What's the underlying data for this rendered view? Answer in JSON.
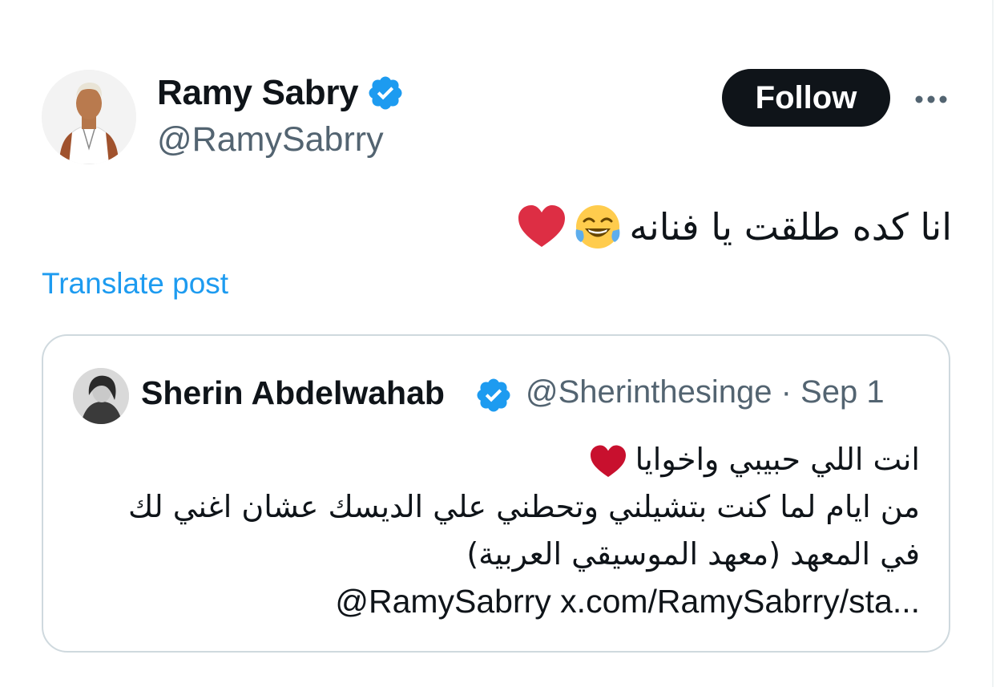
{
  "author": {
    "display_name": "Ramy Sabry",
    "handle": "@RamySabrry",
    "verified": true
  },
  "header": {
    "follow_label": "Follow"
  },
  "post": {
    "text": "انا كده طلقت يا فنانه",
    "emojis": [
      "face-with-tears-of-joy",
      "red-heart"
    ],
    "translate_label": "Translate post"
  },
  "quote": {
    "author_name": "Sherin Abdelwahab",
    "handle": "@Sherinthesinge",
    "separator": "·",
    "date": "Sep 1",
    "lines": [
      "انت اللي حبيبي واخوايا",
      "من ايام لما كنت بتشيلني وتحطني علي الديسك عشان اغني لك",
      "في المعهد (معهد الموسيقي العربية)"
    ],
    "link_text": "@RamySabrry x.com/RamySabrry/sta..."
  },
  "colors": {
    "accent": "#1d9bf0",
    "text_primary": "#0f1419",
    "text_secondary": "#536471",
    "border": "#cfd9de",
    "heart": "#f91880"
  }
}
